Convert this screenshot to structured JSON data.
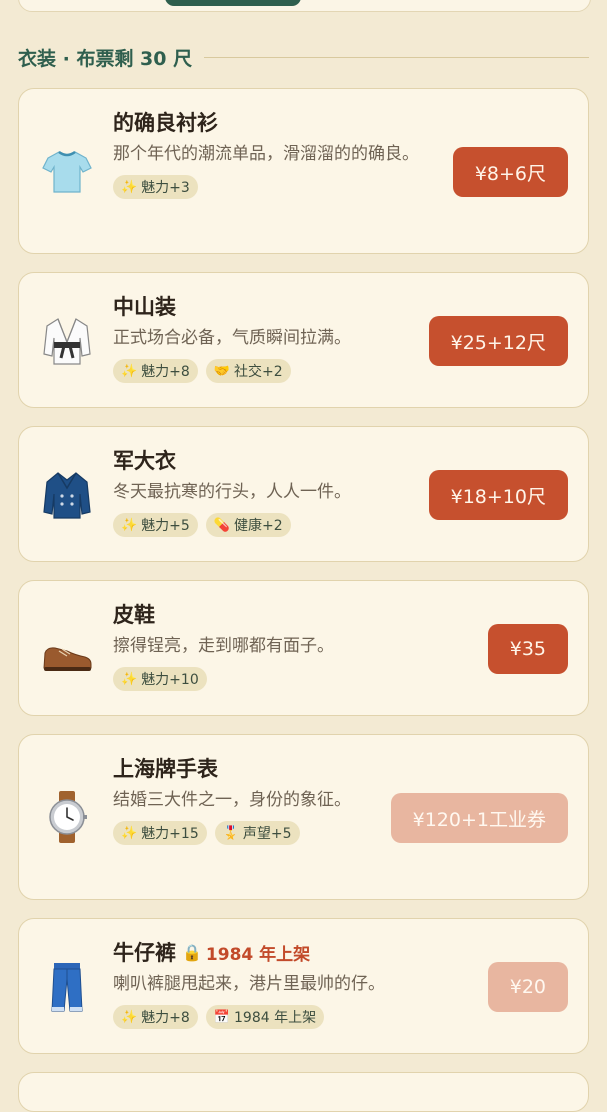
{
  "section": {
    "title": "衣装 · 布票剩 30 尺"
  },
  "items": [
    {
      "name": "的确良衬衫",
      "desc": "那个年代的潮流单品，滑溜溜的的确良。",
      "price": "¥8+6尺",
      "state": "active",
      "icon": "tshirt-icon",
      "tags": [
        {
          "icon": "sparkle",
          "text": "魅力+3"
        }
      ]
    },
    {
      "name": "中山装",
      "desc": "正式场合必备，气质瞬间拉满。",
      "price": "¥25+12尺",
      "state": "active",
      "icon": "suit-icon",
      "tags": [
        {
          "icon": "sparkle",
          "text": "魅力+8"
        },
        {
          "icon": "handshake",
          "text": "社交+2"
        }
      ]
    },
    {
      "name": "军大衣",
      "desc": "冬天最抗寒的行头，人人一件。",
      "price": "¥18+10尺",
      "state": "active",
      "icon": "coat-icon",
      "tags": [
        {
          "icon": "sparkle",
          "text": "魅力+5"
        },
        {
          "icon": "pill",
          "text": "健康+2"
        }
      ]
    },
    {
      "name": "皮鞋",
      "desc": "擦得锃亮，走到哪都有面子。",
      "price": "¥35",
      "state": "active",
      "icon": "shoe-icon",
      "tags": [
        {
          "icon": "sparkle",
          "text": "魅力+10"
        }
      ]
    },
    {
      "name": "上海牌手表",
      "desc": "结婚三大件之一，身份的象征。",
      "price": "¥120+1工业券",
      "state": "disabled",
      "icon": "watch-icon",
      "tags": [
        {
          "icon": "sparkle",
          "text": "魅力+15"
        },
        {
          "icon": "medal",
          "text": "声望+5"
        }
      ]
    },
    {
      "name": "牛仔裤",
      "locked_note": "1984 年上架",
      "desc": "喇叭裤腿甩起来，港片里最帅的仔。",
      "price": "¥20",
      "state": "disabled",
      "icon": "jeans-icon",
      "tags": [
        {
          "icon": "sparkle",
          "text": "魅力+8"
        },
        {
          "icon": "calendar",
          "text": "1984 年上架"
        }
      ]
    }
  ]
}
